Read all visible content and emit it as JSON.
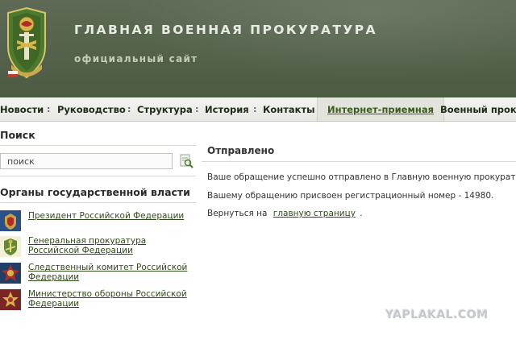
{
  "header": {
    "title": "ГЛАВНАЯ ВОЕННАЯ ПРОКУРАТУРА",
    "subtitle": "официальный сайт"
  },
  "nav": {
    "items": [
      {
        "label": "Новости"
      },
      {
        "label": "Руководство"
      },
      {
        "label": "Структура"
      },
      {
        "label": "История"
      },
      {
        "label": "Контакты"
      },
      {
        "label": "Интернет-приемная"
      },
      {
        "label": "Военный проку"
      }
    ],
    "separator": ":",
    "active_index": 5
  },
  "sidebar": {
    "search_heading": "Поиск",
    "search_value": "поиск",
    "gov_heading": "Органы государственной власти",
    "gov_items": [
      {
        "label": "Президент Российской Федерации",
        "icon": "presidential-emblem-icon"
      },
      {
        "label": "Генеральная прокуратура Российской Федерации",
        "icon": "prosecutor-emblem-icon"
      },
      {
        "label": "Следственный комитет Российской Федерации",
        "icon": "investigative-committee-emblem-icon"
      },
      {
        "label": "Министерство обороны Российской Федерации",
        "icon": "defense-ministry-emblem-icon"
      }
    ]
  },
  "main": {
    "title": "Отправлено",
    "line1": "Ваше обращение успешно отправлено в Главную военную прокуратуру.",
    "line2": "Вашему обращению присвоен регистрационный номер - 14980.",
    "line3_prefix": "Вернуться на",
    "line3_link": "главную страницу",
    "line3_suffix": "."
  },
  "watermark": "YAPLAKAL.COM",
  "colors": {
    "header_bg": "#56634d",
    "nav_bg": "#ecede8",
    "link": "#2f4a1b",
    "active_nav": "#3a5a1e"
  }
}
